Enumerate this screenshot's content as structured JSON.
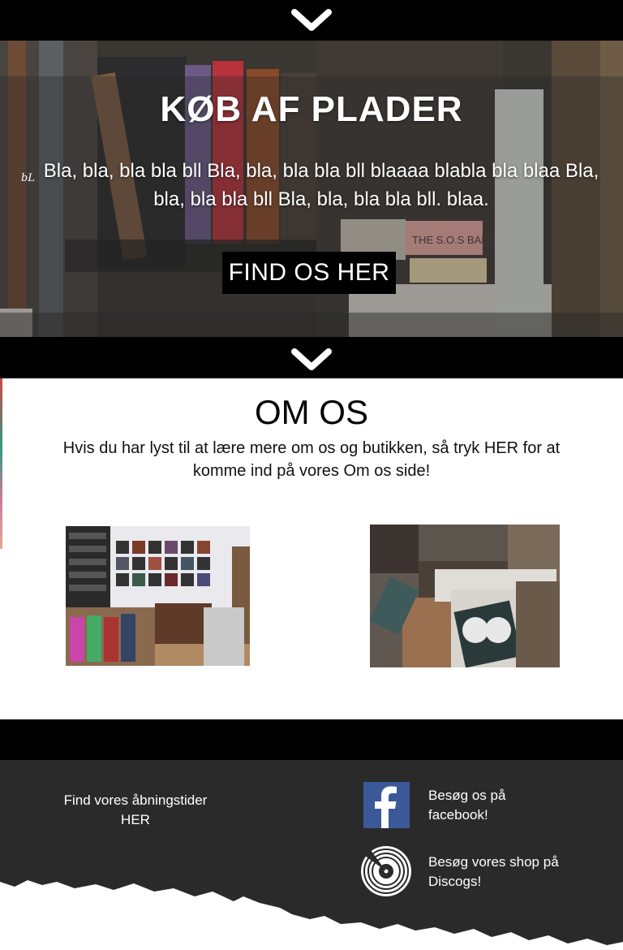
{
  "hero": {
    "title": "KØB AF PLADER",
    "signature": "bL",
    "text": "Bla, bla, bla bla bll Bla, bla, bla bla bll blaaaa blabla bla blaa Bla, bla, bla bla bll Bla, bla, bla bla bll. blaa.",
    "button_label": "FIND OS HER"
  },
  "about": {
    "title": "OM OS",
    "text": "Hvis du har lyst til at lære mere om os og butikken, så tryk HER for at komme ind på vores Om os side!"
  },
  "footer": {
    "hours_text": "Find vores åbningstider HER",
    "facebook_text": "Besøg os på facebook!",
    "discogs_text": "Besøg vores shop på Discogs!"
  },
  "icons": {
    "scroll_down_top": "chevron-down-icon",
    "scroll_down_middle": "chevron-down-icon",
    "facebook": "facebook-icon",
    "discogs": "vinyl-record-icon"
  },
  "colors": {
    "bar": "#000000",
    "footer": "#2a2a2a",
    "facebook_blue": "#3b5998",
    "text_light": "#ffffff"
  }
}
